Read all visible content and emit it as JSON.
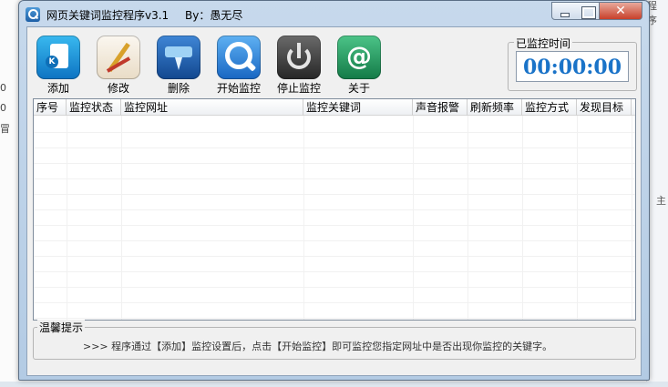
{
  "background": {
    "left_fragments": [
      "0",
      "0",
      "冒"
    ],
    "right_fragments": [
      "程序",
      "主"
    ]
  },
  "window": {
    "title": "网页关键词监控程序v3.1",
    "author": "By：愚无尽",
    "close_glyph": "✕"
  },
  "toolbar": [
    {
      "label": "添加",
      "icon": "add-list-icon"
    },
    {
      "label": "修改",
      "icon": "edit-tools-icon"
    },
    {
      "label": "删除",
      "icon": "delete-icon"
    },
    {
      "label": "开始监控",
      "icon": "magnifier-icon"
    },
    {
      "label": "停止监控",
      "icon": "power-icon"
    },
    {
      "label": "关于",
      "icon": "at-sign-icon"
    }
  ],
  "timer": {
    "legend": "已监控时间",
    "value": "00:00:00"
  },
  "table": {
    "columns": [
      "序号",
      "监控状态",
      "监控网址",
      "监控关键词",
      "声音报警",
      "刷新频率",
      "监控方式",
      "发现目标"
    ],
    "rows": []
  },
  "tips": {
    "legend": "温馨提示",
    "text": ">>> 程序通过【添加】监控设置后，点击【开始监控】即可监控您指定网址中是否出现你监控的关键字。"
  },
  "about_glyph": "@"
}
